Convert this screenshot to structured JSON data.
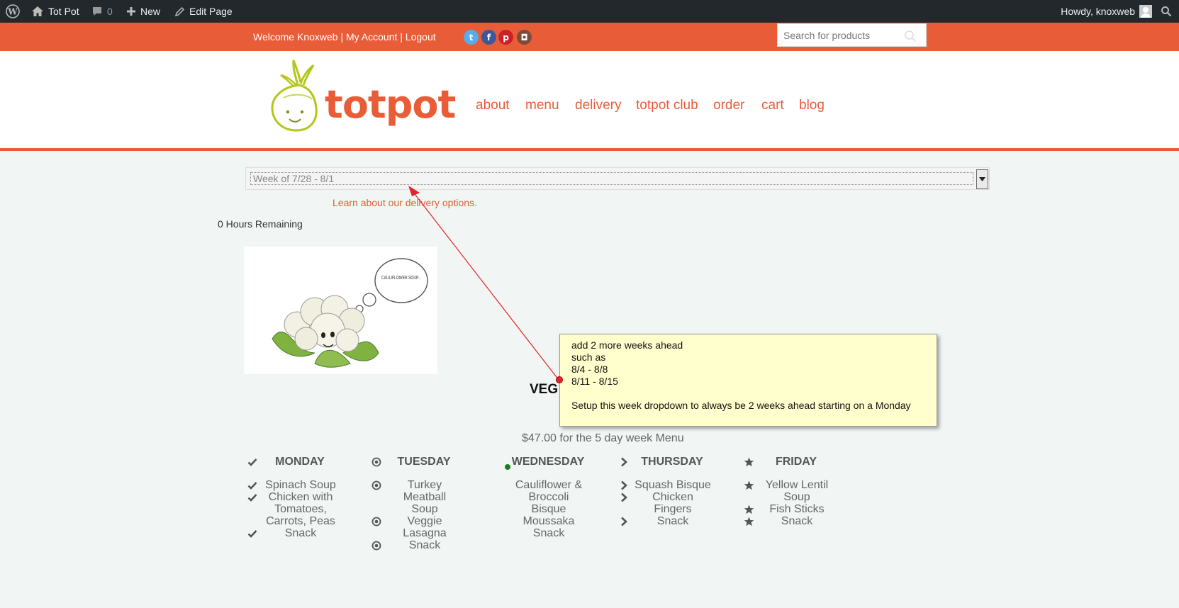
{
  "admin_bar": {
    "site_name": "Tot Pot",
    "comments_count": "0",
    "new_label": "New",
    "edit_label": "Edit Page",
    "howdy": "Howdy, knoxweb"
  },
  "topbar": {
    "welcome": "Welcome Knoxweb",
    "sep": "|",
    "my_account": "My Account",
    "logout": "Logout",
    "search_placeholder": "Search for products",
    "social": [
      {
        "icon": "twitter-icon",
        "color": "#55acee",
        "glyph": "t"
      },
      {
        "icon": "facebook-icon",
        "color": "#3b5998",
        "glyph": "f"
      },
      {
        "icon": "pinterest-icon",
        "color": "#cb2027",
        "glyph": "p"
      },
      {
        "icon": "instagram-icon",
        "color": "#7b4b3a",
        "glyph": "◘"
      }
    ]
  },
  "header": {
    "logo_text": "totpot",
    "nav": [
      "about",
      "menu",
      "delivery",
      "totpot club",
      "order",
      "cart",
      "blog"
    ]
  },
  "week_select": {
    "value": "Week of 7/28 - 8/1"
  },
  "learn_link": "Learn about our delivery options.",
  "hours_remaining": "0 Hours Remaining",
  "image_thought": "CAULIFLOWER SOUP...",
  "veg_label": "VEG",
  "price_text": "$47.00 for the 5 day week Menu",
  "days": [
    {
      "name": "MONDAY",
      "icon": "check-icon",
      "items": [
        {
          "text": "Spinach Soup",
          "lines": 1,
          "icon": true
        },
        {
          "text": "Chicken with Tomatoes, Carrots, Peas",
          "lines": 3,
          "icon": true
        },
        {
          "text": "Snack",
          "lines": 1,
          "icon": true
        }
      ]
    },
    {
      "name": "TUESDAY",
      "icon": "dot-circle-icon",
      "items": [
        {
          "text": "Turkey Meatball Soup",
          "lines": 2,
          "icon": true
        },
        {
          "text": "Veggie Lasagna",
          "lines": 2,
          "icon": true
        },
        {
          "text": "Snack",
          "lines": 1,
          "icon": true
        }
      ]
    },
    {
      "name": "WEDNESDAY",
      "icon": "green-dot-icon",
      "items": [
        {
          "text": "Cauliflower & Broccoli Bisque",
          "lines": 3,
          "icon": false
        },
        {
          "text": "Moussaka",
          "lines": 1,
          "icon": false
        },
        {
          "text": "Snack",
          "lines": 1,
          "icon": false
        }
      ]
    },
    {
      "name": "THURSDAY",
      "icon": "chevron-right-icon",
      "items": [
        {
          "text": "Squash Bisque",
          "lines": 1,
          "icon": true
        },
        {
          "text": "Chicken Fingers",
          "lines": 2,
          "icon": true
        },
        {
          "text": "Snack",
          "lines": 1,
          "icon": true
        }
      ]
    },
    {
      "name": "FRIDAY",
      "icon": "star-icon",
      "items": [
        {
          "text": "Yellow Lentil Soup",
          "lines": 2,
          "icon": true
        },
        {
          "text": "Fish Sticks",
          "lines": 1,
          "icon": true
        },
        {
          "text": "Snack",
          "lines": 1,
          "icon": true
        }
      ]
    }
  ],
  "annotation": {
    "lines": [
      "add 2 more weeks ahead",
      "such as",
      "8/4 - 8/8",
      "8/11 - 8/15",
      "",
      "Setup this week dropdown to always be 2 weeks ahead starting on a Monday"
    ]
  },
  "colors": {
    "brand_orange": "#e85c37",
    "admin_bar": "#23282d",
    "note_bg": "#fffecc",
    "annotation_arrow": "#e0252b"
  }
}
